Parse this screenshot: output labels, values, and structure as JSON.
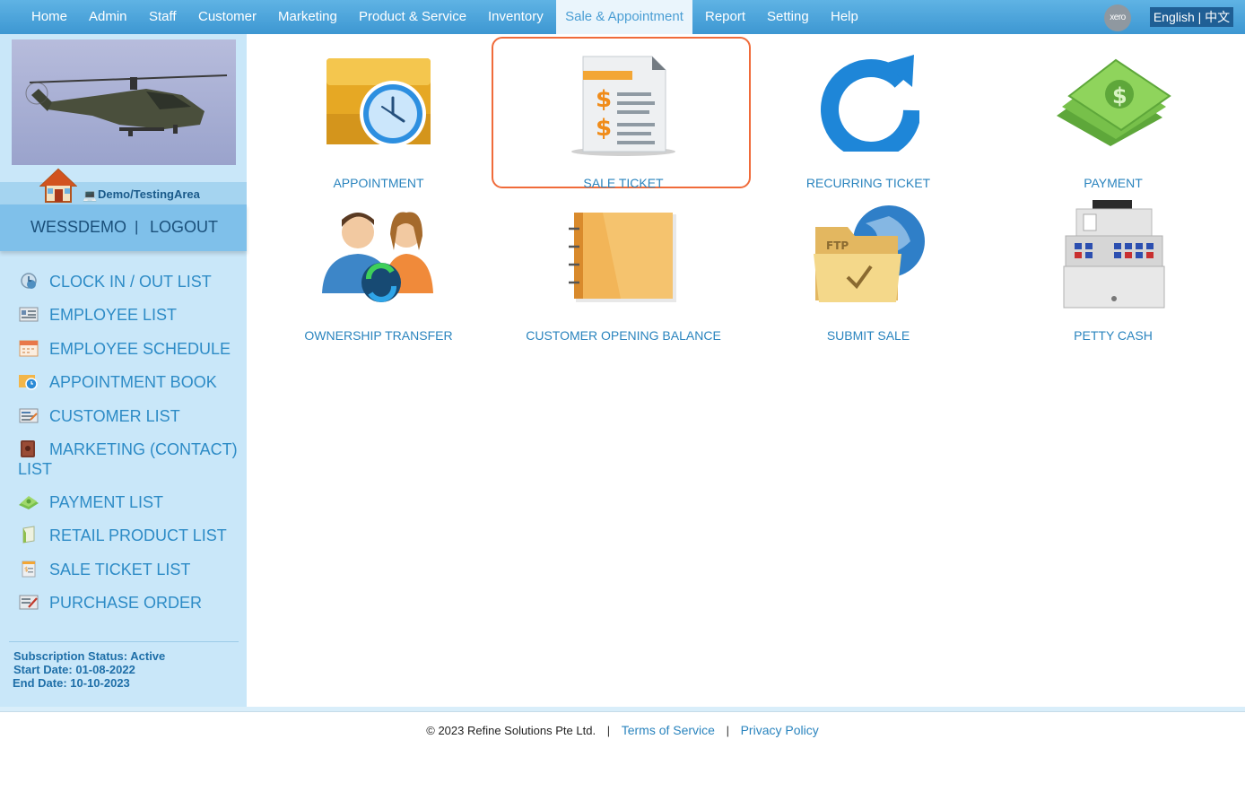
{
  "nav": {
    "items": [
      "Home",
      "Admin",
      "Staff",
      "Customer",
      "Marketing",
      "Product & Service",
      "Inventory",
      "Sale & Appointment",
      "Report",
      "Setting",
      "Help"
    ],
    "active": "Sale & Appointment",
    "xero_label": "xero",
    "language": "English | 中文"
  },
  "sidebar": {
    "demo_area": "Demo/TestingArea",
    "user": "WESSDEMO",
    "separator": "|",
    "logout": "LOGOUT",
    "menu": [
      {
        "label": "CLOCK IN / OUT LIST",
        "icon": "clock-icon"
      },
      {
        "label": "EMPLOYEE LIST",
        "icon": "employee-card-icon"
      },
      {
        "label": "EMPLOYEE SCHEDULE",
        "icon": "calendar-icon"
      },
      {
        "label": "APPOINTMENT BOOK",
        "icon": "appointment-icon"
      },
      {
        "label": "CUSTOMER LIST",
        "icon": "customer-list-icon"
      },
      {
        "label": "MARKETING (CONTACT) LIST",
        "icon": "contact-book-icon"
      },
      {
        "label": "PAYMENT LIST",
        "icon": "money-icon"
      },
      {
        "label": "RETAIL PRODUCT LIST",
        "icon": "product-icon"
      },
      {
        "label": "SALE TICKET LIST",
        "icon": "ticket-icon"
      },
      {
        "label": "PURCHASE ORDER",
        "icon": "purchase-order-icon"
      }
    ],
    "subscription": {
      "status": "Subscription Status: Active",
      "start": "Start Date: 01-08-2022",
      "end": "End Date: 10-10-2023"
    }
  },
  "tiles": [
    {
      "label": "APPOINTMENT",
      "icon": "appointment-clock-icon"
    },
    {
      "label": "SALE TICKET",
      "icon": "sale-ticket-icon",
      "highlighted": true
    },
    {
      "label": "RECURRING TICKET",
      "icon": "recurring-arrow-icon"
    },
    {
      "label": "PAYMENT",
      "icon": "cash-icon"
    },
    {
      "label": "OWNERSHIP TRANSFER",
      "icon": "people-transfer-icon"
    },
    {
      "label": "CUSTOMER OPENING BALANCE",
      "icon": "notebook-icon"
    },
    {
      "label": "SUBMIT SALE",
      "icon": "ftp-folder-icon"
    },
    {
      "label": "PETTY CASH",
      "icon": "cash-register-icon"
    }
  ],
  "footer": {
    "copyright": "© 2023 Refine Solutions Pte Ltd.",
    "sep": "|",
    "terms": "Terms of Service",
    "privacy": "Privacy Policy"
  },
  "colors": {
    "nav_blue": "#3d97d2",
    "sidebar_bg": "#c9e7f9",
    "link_blue": "#2a84be",
    "highlight_orange": "#f06b3a"
  }
}
